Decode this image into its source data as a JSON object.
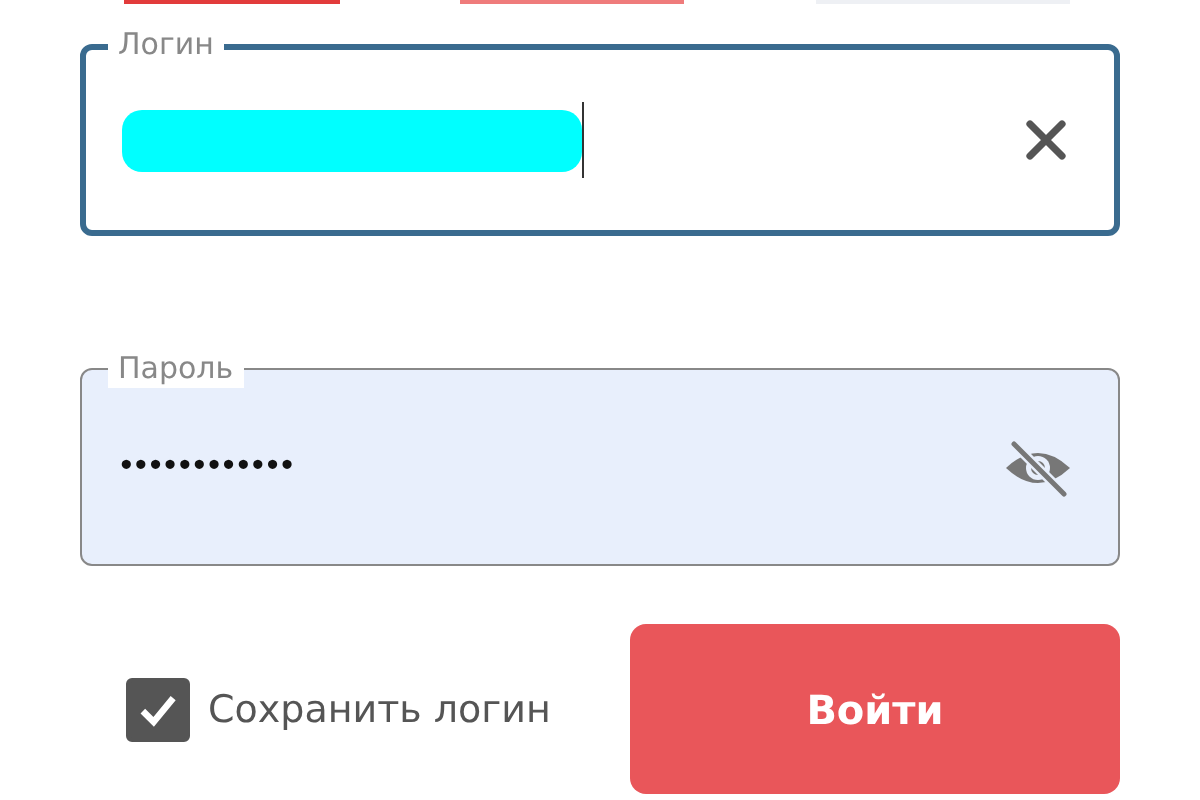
{
  "login_field": {
    "label": "Логин",
    "focused": true
  },
  "password_field": {
    "label": "Пароль",
    "value": "••••••••••••",
    "focused": false
  },
  "remember": {
    "label": "Сохранить логин",
    "checked": true
  },
  "submit_button": {
    "label": "Войти"
  }
}
